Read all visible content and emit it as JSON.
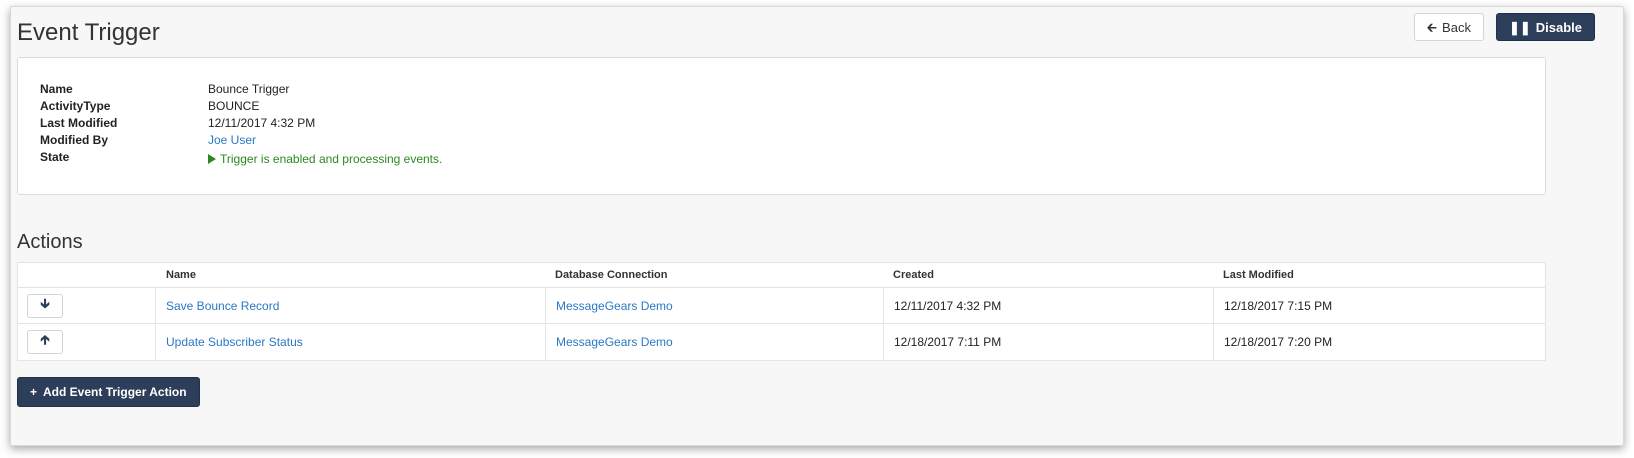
{
  "header": {
    "title": "Event Trigger",
    "back_label": "Back",
    "disable_label": "Disable"
  },
  "details": {
    "name_label": "Name",
    "name_value": "Bounce Trigger",
    "activity_type_label": "ActivityType",
    "activity_type_value": "BOUNCE",
    "last_modified_label": "Last Modified",
    "last_modified_value": "12/11/2017 4:32 PM",
    "modified_by_label": "Modified By",
    "modified_by_value": "Joe User",
    "state_label": "State",
    "state_value": "Trigger is enabled and processing events."
  },
  "actions": {
    "title": "Actions",
    "columns": [
      "Name",
      "Database Connection",
      "Created",
      "Last Modified"
    ],
    "rows": [
      {
        "name": "Save Bounce Record",
        "connection": "MessageGears Demo",
        "created": "12/11/2017 4:32 PM",
        "last_modified": "12/18/2017 7:15 PM",
        "move_icon": "arrow-down-icon"
      },
      {
        "name": "Update Subscriber Status",
        "connection": "MessageGears Demo",
        "created": "12/18/2017 7:11 PM",
        "last_modified": "12/18/2017 7:20 PM",
        "move_icon": "arrow-up-icon"
      }
    ],
    "add_label": "Add Event Trigger Action"
  },
  "colors": {
    "primary": "#2d3e5a",
    "link": "#2a78c5",
    "success": "#2b8a1e"
  }
}
